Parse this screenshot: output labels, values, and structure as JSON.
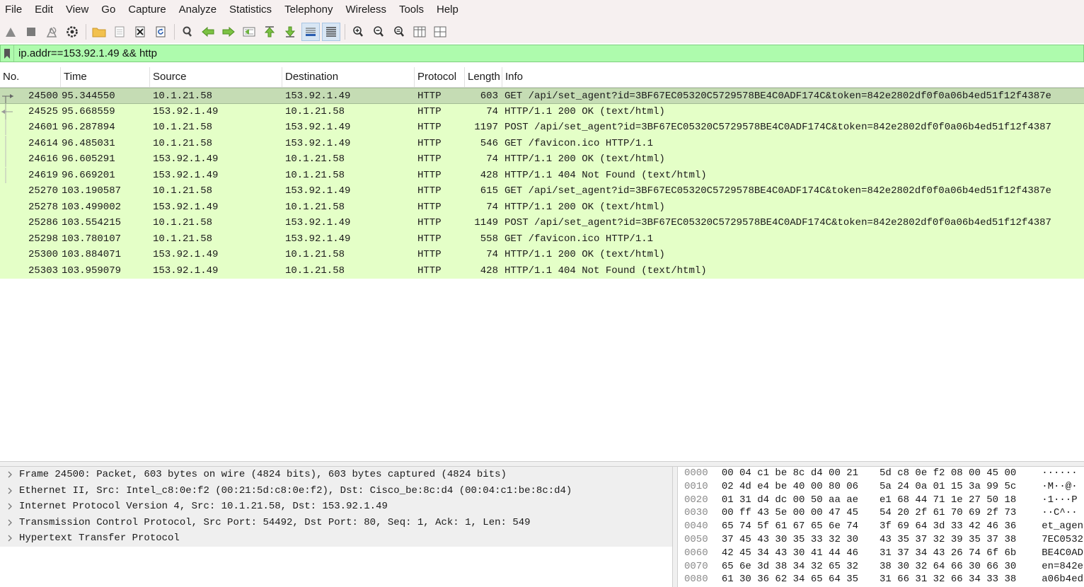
{
  "menu": [
    "File",
    "Edit",
    "View",
    "Go",
    "Capture",
    "Analyze",
    "Statistics",
    "Telephony",
    "Wireless",
    "Tools",
    "Help"
  ],
  "filter": {
    "value": "ip.addr==153.92.1.49 && http"
  },
  "columns": {
    "no": "No.",
    "time": "Time",
    "source": "Source",
    "destination": "Destination",
    "protocol": "Protocol",
    "length": "Length",
    "info": "Info"
  },
  "packets": [
    {
      "no": "24500",
      "time": "95.344550",
      "src": "10.1.21.58",
      "dst": "153.92.1.49",
      "proto": "HTTP",
      "len": "603",
      "info": "GET /api/set_agent?id=3BF67EC05320C5729578BE4C0ADF174C&token=842e2802df0f0a06b4ed51f12f4387e"
    },
    {
      "no": "24525",
      "time": "95.668559",
      "src": "153.92.1.49",
      "dst": "10.1.21.58",
      "proto": "HTTP",
      "len": "74",
      "info": "HTTP/1.1 200 OK  (text/html)"
    },
    {
      "no": "24601",
      "time": "96.287894",
      "src": "10.1.21.58",
      "dst": "153.92.1.49",
      "proto": "HTTP",
      "len": "1197",
      "info": "POST /api/set_agent?id=3BF67EC05320C5729578BE4C0ADF174C&token=842e2802df0f0a06b4ed51f12f4387"
    },
    {
      "no": "24614",
      "time": "96.485031",
      "src": "10.1.21.58",
      "dst": "153.92.1.49",
      "proto": "HTTP",
      "len": "546",
      "info": "GET /favicon.ico HTTP/1.1"
    },
    {
      "no": "24616",
      "time": "96.605291",
      "src": "153.92.1.49",
      "dst": "10.1.21.58",
      "proto": "HTTP",
      "len": "74",
      "info": "HTTP/1.1 200 OK  (text/html)"
    },
    {
      "no": "24619",
      "time": "96.669201",
      "src": "153.92.1.49",
      "dst": "10.1.21.58",
      "proto": "HTTP",
      "len": "428",
      "info": "HTTP/1.1 404 Not Found  (text/html)"
    },
    {
      "no": "25270",
      "time": "103.190587",
      "src": "10.1.21.58",
      "dst": "153.92.1.49",
      "proto": "HTTP",
      "len": "615",
      "info": "GET /api/set_agent?id=3BF67EC05320C5729578BE4C0ADF174C&token=842e2802df0f0a06b4ed51f12f4387e"
    },
    {
      "no": "25278",
      "time": "103.499002",
      "src": "153.92.1.49",
      "dst": "10.1.21.58",
      "proto": "HTTP",
      "len": "74",
      "info": "HTTP/1.1 200 OK  (text/html)"
    },
    {
      "no": "25286",
      "time": "103.554215",
      "src": "10.1.21.58",
      "dst": "153.92.1.49",
      "proto": "HTTP",
      "len": "1149",
      "info": "POST /api/set_agent?id=3BF67EC05320C5729578BE4C0ADF174C&token=842e2802df0f0a06b4ed51f12f4387"
    },
    {
      "no": "25298",
      "time": "103.780107",
      "src": "10.1.21.58",
      "dst": "153.92.1.49",
      "proto": "HTTP",
      "len": "558",
      "info": "GET /favicon.ico HTTP/1.1"
    },
    {
      "no": "25300",
      "time": "103.884071",
      "src": "153.92.1.49",
      "dst": "10.1.21.58",
      "proto": "HTTP",
      "len": "74",
      "info": "HTTP/1.1 200 OK  (text/html)"
    },
    {
      "no": "25303",
      "time": "103.959079",
      "src": "153.92.1.49",
      "dst": "10.1.21.58",
      "proto": "HTTP",
      "len": "428",
      "info": "HTTP/1.1 404 Not Found  (text/html)"
    }
  ],
  "details": [
    "Frame 24500: Packet, 603 bytes on wire (4824 bits), 603 bytes captured (4824 bits)",
    "Ethernet II, Src: Intel_c8:0e:f2 (00:21:5d:c8:0e:f2), Dst: Cisco_be:8c:d4 (00:04:c1:be:8c:d4)",
    "Internet Protocol Version 4, Src: 10.1.21.58, Dst: 153.92.1.49",
    "Transmission Control Protocol, Src Port: 54492, Dst Port: 80, Seq: 1, Ack: 1, Len: 549",
    "Hypertext Transfer Protocol"
  ],
  "bytes": [
    {
      "off": "0000",
      "hex1": "00 04 c1 be 8c d4 00 21",
      "hex2": "5d c8 0e f2 08 00 45 00",
      "ascii": "······"
    },
    {
      "off": "0010",
      "hex1": "02 4d e4 be 40 00 80 06",
      "hex2": "5a 24 0a 01 15 3a 99 5c",
      "ascii": "·M··@·"
    },
    {
      "off": "0020",
      "hex1": "01 31 d4 dc 00 50 aa ae",
      "hex2": "e1 68 44 71 1e 27 50 18",
      "ascii": "·1···P"
    },
    {
      "off": "0030",
      "hex1": "00 ff 43 5e 00 00 47 45",
      "hex2": "54 20 2f 61 70 69 2f 73",
      "ascii": "··C^··"
    },
    {
      "off": "0040",
      "hex1": "65 74 5f 61 67 65 6e 74",
      "hex2": "3f 69 64 3d 33 42 46 36",
      "ascii": "et_agen"
    },
    {
      "off": "0050",
      "hex1": "37 45 43 30 35 33 32 30",
      "hex2": "43 35 37 32 39 35 37 38",
      "ascii": "7EC0532"
    },
    {
      "off": "0060",
      "hex1": "42 45 34 43 30 41 44 46",
      "hex2": "31 37 34 43 26 74 6f 6b",
      "ascii": "BE4C0AD"
    },
    {
      "off": "0070",
      "hex1": "65 6e 3d 38 34 32 65 32",
      "hex2": "38 30 32 64 66 30 66 30",
      "ascii": "en=842e"
    },
    {
      "off": "0080",
      "hex1": "61 30 36 62 34 65 64 35",
      "hex2": "31 66 31 32 66 34 33 38",
      "ascii": "a06b4ed"
    }
  ],
  "colors": {
    "http_row": "#e4ffc7",
    "selected_row": "#c5dcb4",
    "filter_ok": "#aefbad",
    "chrome": "#f6f0f0"
  }
}
